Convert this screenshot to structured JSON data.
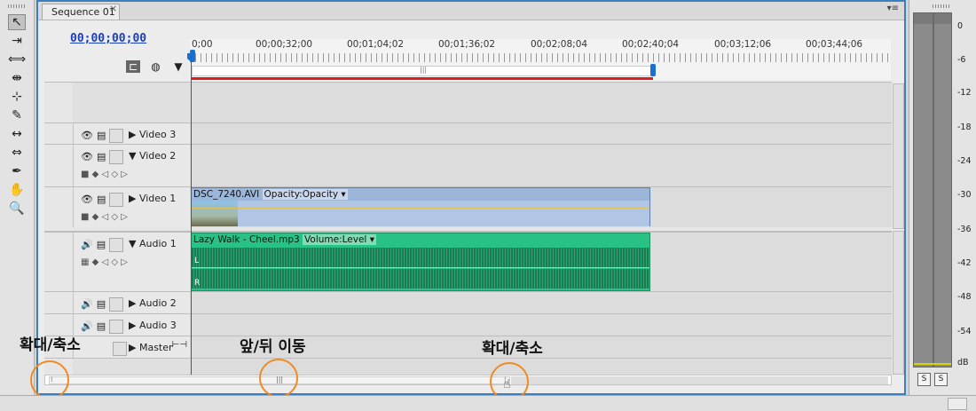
{
  "tab": {
    "title": "Sequence 01",
    "close": "×",
    "menu": "▾≡"
  },
  "timecode": "00;00;00;00",
  "ruler_ticks": [
    "0;00",
    "00;00;32;00",
    "00;01;04;02",
    "00;01;36;02",
    "00;02;08;04",
    "00;02;40;04",
    "00;03;12;06",
    "00;03;44;06"
  ],
  "ruler_grip": "|||",
  "tracks": {
    "video3": "Video 3",
    "video2": "Video 2",
    "video1": "Video 1",
    "audio1": "Audio 1",
    "audio2": "Audio 2",
    "audio3": "Audio 3",
    "master": "Master"
  },
  "clips": {
    "video": {
      "name": "DSC_7240.AVI",
      "effect": "Opacity:Opacity ▾"
    },
    "audio": {
      "name": "Lazy Walk - Cheel.mp3",
      "effect": "Volume:Level ▾",
      "left_channel": "L",
      "right_channel": "R"
    }
  },
  "annotations": {
    "left": "확대/축소",
    "center": "앞/뒤 이동",
    "right": "확대/축소"
  },
  "meter": {
    "labels": [
      "0",
      "-6",
      "-12",
      "-18",
      "-24",
      "-30",
      "-36",
      "-42",
      "-48",
      "-54",
      "dB"
    ],
    "solo_left": "S",
    "solo_right": "S"
  },
  "colors": {
    "accent": "#3a7fc1",
    "playhead": "#d82020",
    "video_clip": "#9bb6d9",
    "audio_clip": "#29c286",
    "annotation_circle": "#f08a24"
  },
  "icons": [
    "selection-icon",
    "track-select-icon",
    "ripple-edit-icon",
    "rolling-edit-icon",
    "rate-stretch-icon",
    "razor-icon",
    "slip-icon",
    "slide-icon",
    "pen-icon",
    "hand-icon",
    "zoom-icon",
    "eye-icon",
    "lock-icon",
    "speaker-icon",
    "snap-icon",
    "marker-icon"
  ]
}
